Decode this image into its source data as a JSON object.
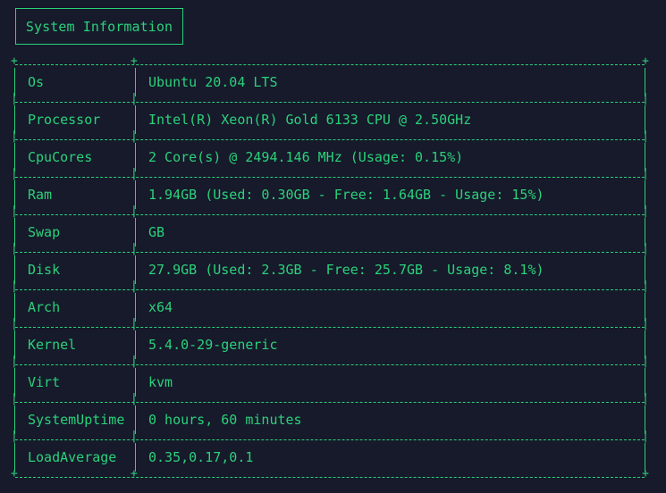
{
  "header": {
    "title": "System Information"
  },
  "colors": {
    "background": "#161a2b",
    "text": "#2bd17a"
  },
  "rows": [
    {
      "key": "Os",
      "value": "Ubuntu 20.04 LTS"
    },
    {
      "key": "Processor",
      "value": "Intel(R) Xeon(R) Gold 6133 CPU @ 2.50GHz"
    },
    {
      "key": "CpuCores",
      "value": "2 Core(s) @ 2494.146 MHz (Usage: 0.15%)"
    },
    {
      "key": "Ram",
      "value": "1.94GB (Used: 0.30GB - Free: 1.64GB - Usage: 15%)"
    },
    {
      "key": "Swap",
      "value": "GB"
    },
    {
      "key": "Disk",
      "value": "27.9GB (Used: 2.3GB - Free: 25.7GB - Usage: 8.1%)"
    },
    {
      "key": "Arch",
      "value": "x64"
    },
    {
      "key": "Kernel",
      "value": "5.4.0-29-generic"
    },
    {
      "key": "Virt",
      "value": "kvm"
    },
    {
      "key": "SystemUptime",
      "value": "0 hours, 60 minutes"
    },
    {
      "key": "LoadAverage",
      "value": "0.35,0.17,0.1"
    }
  ]
}
